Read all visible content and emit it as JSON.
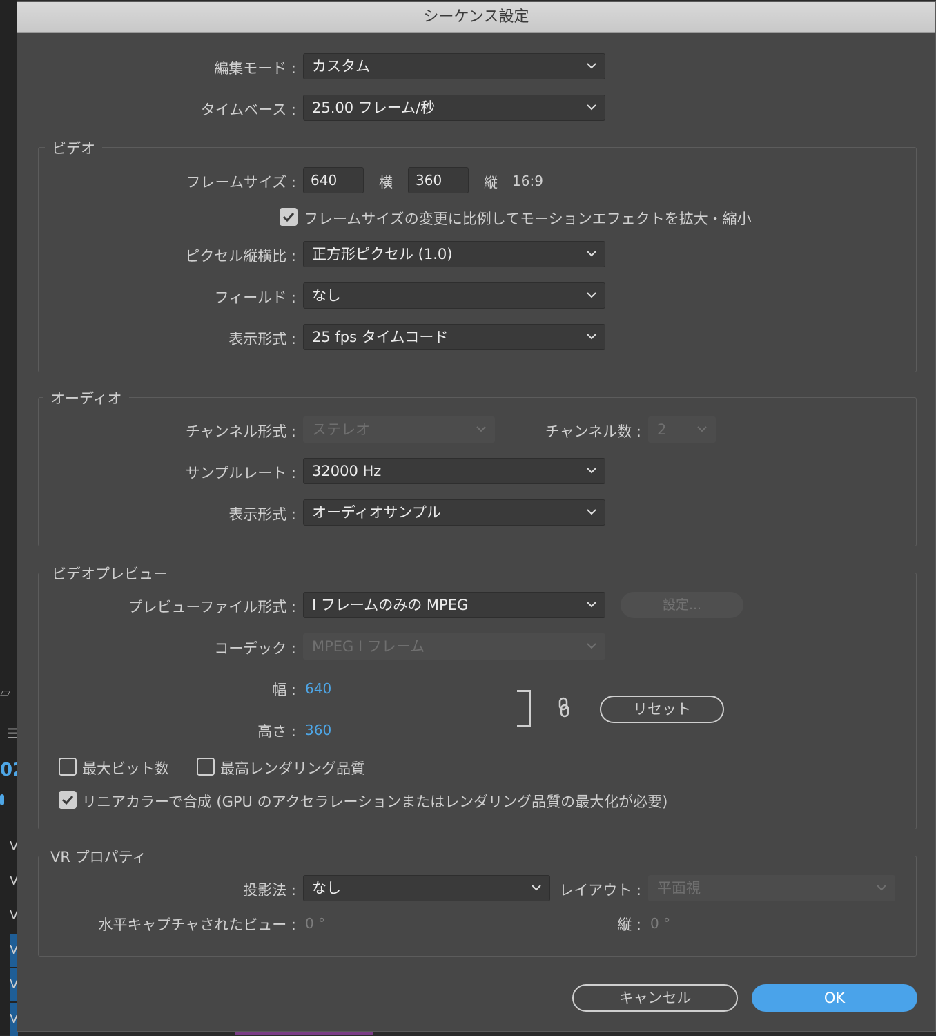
{
  "dialog": {
    "title": "シーケンス設定"
  },
  "top": {
    "edit_mode": {
      "label": "編集モード :",
      "value": "カスタム"
    },
    "timebase": {
      "label": "タイムベース :",
      "value": "25.00  フレーム/秒"
    }
  },
  "video": {
    "legend": "ビデオ",
    "frame_size": {
      "label": "フレームサイズ :",
      "width": "640",
      "width_unit": "横",
      "height": "360",
      "height_unit": "縦",
      "aspect": "16:9"
    },
    "scale_motion": {
      "checked": true,
      "label": "フレームサイズの変更に比例してモーションエフェクトを拡大・縮小"
    },
    "pixel_aspect": {
      "label": "ピクセル縦横比 :",
      "value": "正方形ピクセル (1.0)"
    },
    "fields": {
      "label": "フィールド :",
      "value": "なし"
    },
    "display_format": {
      "label": "表示形式 :",
      "value": "25 fps タイムコード"
    }
  },
  "audio": {
    "legend": "オーディオ",
    "channel_format": {
      "label": "チャンネル形式 :",
      "value": "ステレオ"
    },
    "channel_count": {
      "label": "チャンネル数 :",
      "value": "2"
    },
    "sample_rate": {
      "label": "サンプルレート :",
      "value": "32000 Hz"
    },
    "display_format": {
      "label": "表示形式 :",
      "value": "オーディオサンプル"
    }
  },
  "preview": {
    "legend": "ビデオプレビュー",
    "file_format": {
      "label": "プレビューファイル形式 :",
      "value": "I フレームのみの MPEG"
    },
    "settings_button": "設定...",
    "codec": {
      "label": "コーデック :",
      "value": "MPEG I フレーム"
    },
    "width": {
      "label": "幅 :",
      "value": "640"
    },
    "height": {
      "label": "高さ :",
      "value": "360"
    },
    "reset_button": "リセット",
    "max_bit_depth": {
      "checked": false,
      "label": "最大ビット数"
    },
    "max_render_quality": {
      "checked": false,
      "label": "最高レンダリング品質"
    },
    "linear_color": {
      "checked": true,
      "label": "リニアカラーで合成 (GPU のアクセラレーションまたはレンダリング品質の最大化が必要)"
    }
  },
  "vr": {
    "legend": "VR プロパティ",
    "projection": {
      "label": "投影法 :",
      "value": "なし"
    },
    "layout": {
      "label": "レイアウト :",
      "value": "平面視"
    },
    "h_view": {
      "label": "水平キャプチャされたビュー :",
      "value": "0 °"
    },
    "v_view": {
      "label": "縦 :",
      "value": "0 °"
    }
  },
  "footer": {
    "cancel": "キャンセル",
    "ok": "OK"
  },
  "background": {
    "frag_text": "02",
    "track_letter": "V",
    "menu_glyph": "☰"
  }
}
